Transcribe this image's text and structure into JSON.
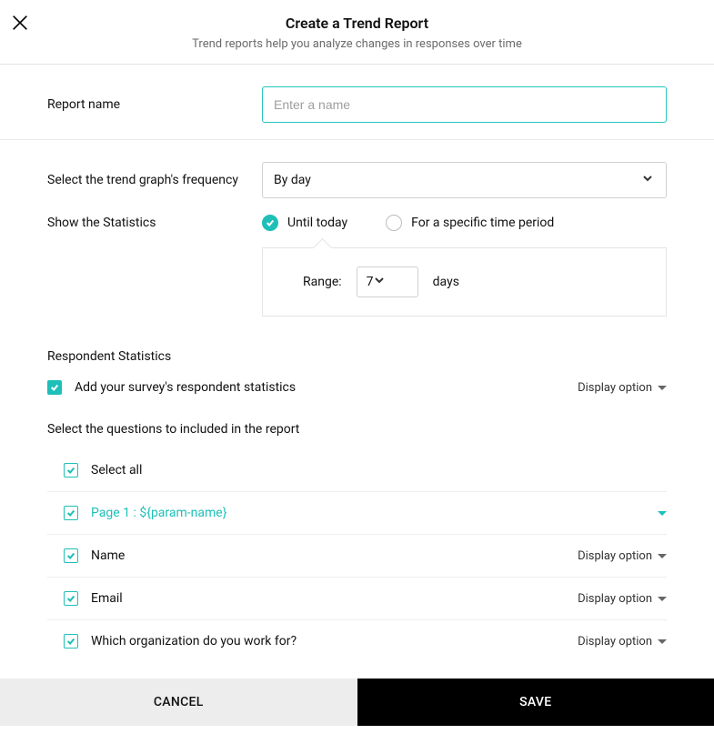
{
  "header": {
    "title": "Create a Trend Report",
    "subtitle": "Trend reports help you analyze changes in responses over time"
  },
  "report_name": {
    "label": "Report name",
    "placeholder": "Enter a name",
    "value": ""
  },
  "frequency": {
    "label": "Select the trend graph's frequency",
    "selected": "By day"
  },
  "statistics": {
    "label": "Show the Statistics",
    "options": {
      "until_today": "Until today",
      "specific_period": "For a specific time period"
    },
    "range": {
      "label": "Range:",
      "value": "7",
      "unit": "days"
    }
  },
  "respondent": {
    "heading": "Respondent Statistics",
    "add_label": "Add your survey's respondent statistics",
    "display_option": "Display option"
  },
  "questions": {
    "heading": "Select the questions to included in the report",
    "select_all": "Select all",
    "page_label": "Page 1 : ${param-name}",
    "display_option": "Display option",
    "items": [
      {
        "label": "Name"
      },
      {
        "label": "Email"
      },
      {
        "label": "Which organization do you work for?"
      }
    ]
  },
  "footer": {
    "cancel": "CANCEL",
    "save": "SAVE"
  }
}
